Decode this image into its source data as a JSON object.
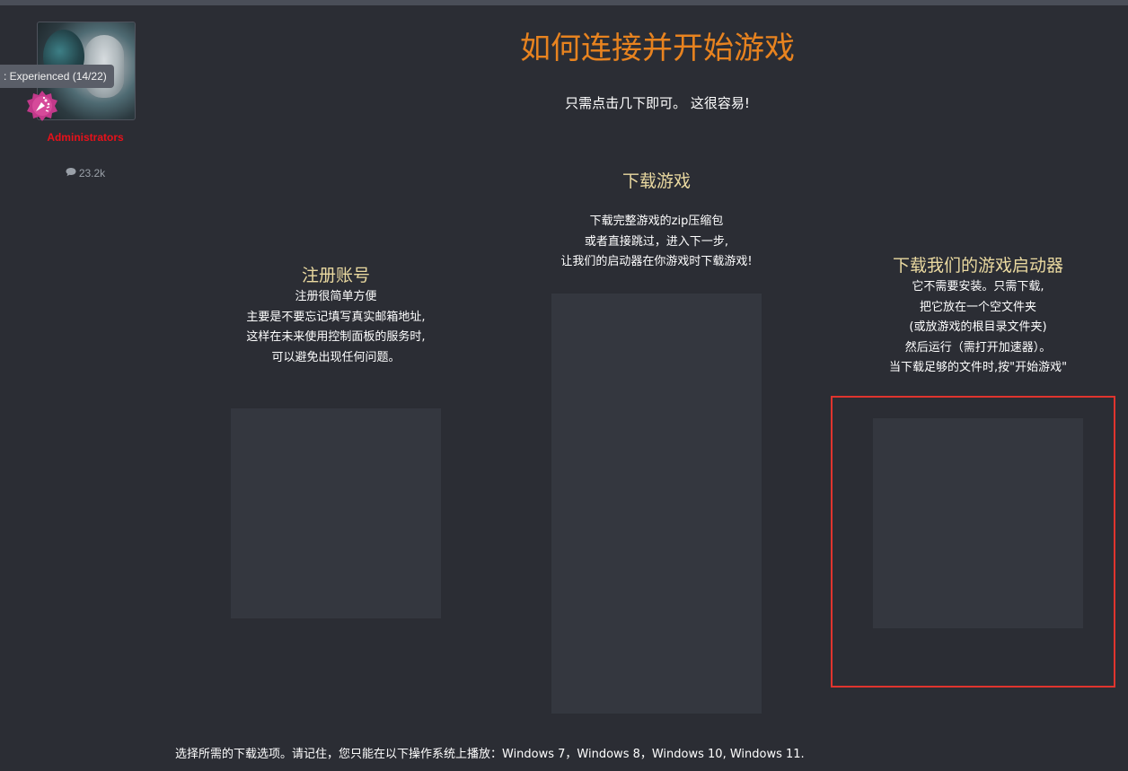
{
  "user_panel": {
    "tooltip": ": Experienced (14/22)",
    "role": "Administrators",
    "message_count": "23.2k",
    "icons": {
      "badge": "trophy-badge-icon",
      "messages": "speech-bubble-icon"
    },
    "colors": {
      "role": "#e8111a",
      "badge": "#c2398a"
    }
  },
  "page": {
    "title": "如何连接并开始游戏",
    "subtitle": "只需点击几下即可。 这很容易!",
    "colors": {
      "title": "#e8831f",
      "heading": "#ead9a0",
      "highlight": "#e0342e"
    }
  },
  "columns": [
    {
      "heading": "注册账号",
      "lines": [
        "注册很简单方便",
        "主要是不要忘记填写真实邮箱地址,",
        "这样在未来使用控制面板的服务时,",
        "可以避免出现任何问题。"
      ]
    },
    {
      "heading": "下载游戏",
      "lines": [
        "下载完整游戏的zip压缩包",
        "或者直接跳过，进入下一步,",
        "让我们的启动器在你游戏时下载游戏!"
      ]
    },
    {
      "heading": "下载我们的游戏启动器",
      "lines": [
        "它不需要安装。只需下载,",
        "把它放在一个空文件夹",
        "(或放游戏的根目录文件夹)",
        "然后运行（需打开加速器）。",
        "当下载足够的文件时,按\"开始游戏\""
      ]
    }
  ],
  "footer": {
    "text": "选择所需的下载选项。请记住，您只能在以下操作系统上播放：Windows 7，Windows 8，Windows 10, Windows 11."
  }
}
